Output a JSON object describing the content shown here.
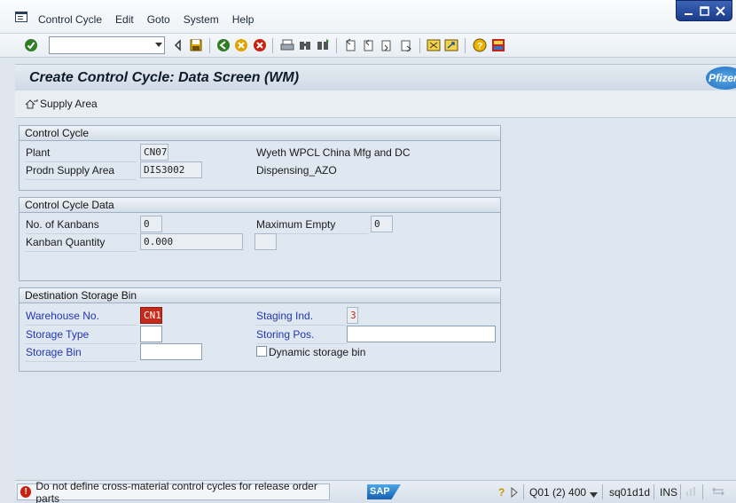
{
  "menu": {
    "items": [
      "Control Cycle",
      "Edit",
      "Goto",
      "System",
      "Help"
    ]
  },
  "window_controls": [
    "minimize",
    "maximize",
    "close"
  ],
  "toolbar": {
    "command_field_value": "",
    "icons": [
      "enter-icon",
      "back-icon",
      "save-icon",
      "back-nav-icon",
      "exit-icon",
      "cancel-icon",
      "print-icon",
      "find-icon",
      "find-next-icon",
      "first-page-icon",
      "previous-page-icon",
      "next-page-icon",
      "last-page-icon",
      "create-session-icon",
      "shortcut-icon",
      "help-icon",
      "customize-layout-icon"
    ]
  },
  "title": "Create Control Cycle: Data Screen (WM)",
  "logo_text": "Pfizer",
  "app_toolbar": {
    "supply_area_label": "Supply Area"
  },
  "groups": {
    "control_cycle": {
      "header": "Control Cycle",
      "plant_label": "Plant",
      "plant_value": "CN07",
      "plant_desc": "Wyeth WPCL China Mfg and DC",
      "psa_label": "Prodn Supply Area",
      "psa_value": "DIS3002",
      "psa_desc": "Dispensing_AZO"
    },
    "control_cycle_data": {
      "header": "Control Cycle Data",
      "num_kanbans_label": "No. of Kanbans",
      "num_kanbans_value": "0",
      "max_empty_label": "Maximum Empty",
      "max_empty_value": "0",
      "kanban_qty_label": "Kanban Quantity",
      "kanban_qty_value": "0.000",
      "unit_value": ""
    },
    "destination_bin": {
      "header": "Destination Storage Bin",
      "warehouse_label": "Warehouse No.",
      "warehouse_value": "CN1",
      "staging_label": "Staging Ind.",
      "staging_value": "3",
      "storage_type_label": "Storage Type",
      "storage_type_value": "",
      "storing_pos_label": "Storing Pos.",
      "storing_pos_value": "",
      "storage_bin_label": "Storage Bin",
      "storage_bin_value": "",
      "dynamic_bin_label": "Dynamic storage bin",
      "dynamic_bin_checked": false
    }
  },
  "status": {
    "message": "Do not define cross-material control cycles for release order parts",
    "system": "Q01 (2) 400",
    "server": "sq01d1d",
    "mode": "INS"
  },
  "colors": {
    "required_label": "#2336b4",
    "error_field": "#c62a1a",
    "error_icon": "#c8210f"
  }
}
